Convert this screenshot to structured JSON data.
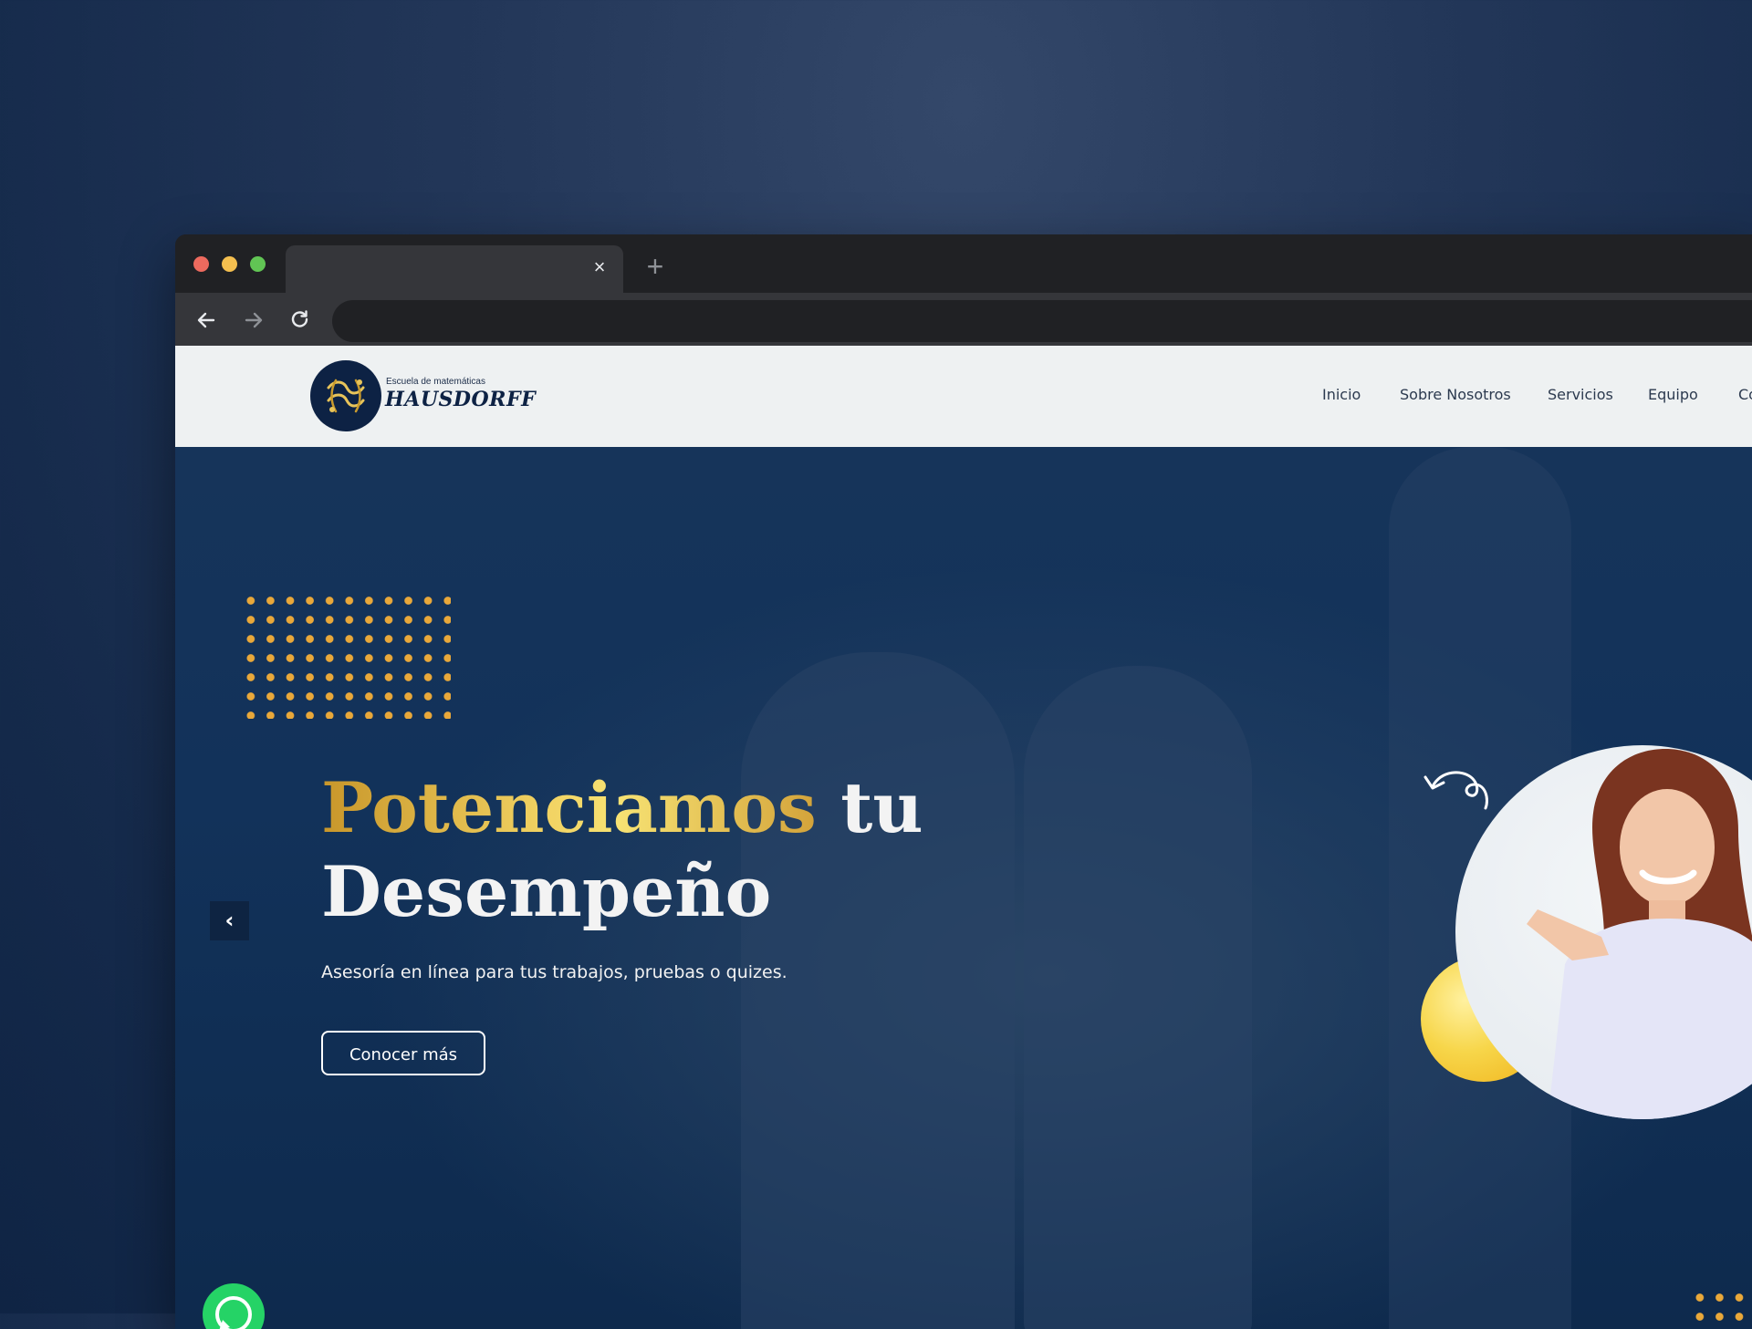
{
  "browser": {
    "tab": {
      "title": "",
      "close_glyph": "×"
    },
    "new_tab_glyph": "+",
    "address": ""
  },
  "site": {
    "logo": {
      "subtitle": "Escuela de matemáticas",
      "name": "HAUSDORFF"
    },
    "nav": [
      {
        "label": "Inicio"
      },
      {
        "label": "Sobre Nosotros"
      },
      {
        "label": "Servicios"
      },
      {
        "label": "Equipo"
      },
      {
        "label": "Co"
      }
    ]
  },
  "hero": {
    "headline_gold": "Potenciamos",
    "headline_rest_line1": " tu",
    "headline_line2": "Desempeño",
    "subtitle": "Asesoría en línea para tus trabajos, pruebas o quizes.",
    "cta_label": "Conocer más",
    "prev_glyph": "‹"
  },
  "colors": {
    "background": "#1b3355",
    "header_bg": "#eef1f2",
    "hero_bg": "#12325a",
    "gold": "#f1d262",
    "dots": "#e9a83a",
    "whatsapp": "#25d366"
  },
  "icons": [
    "back-arrow-icon",
    "forward-arrow-icon",
    "reload-icon",
    "close-icon",
    "plus-icon",
    "whatsapp-icon",
    "curly-arrow-icon",
    "chevron-left-icon"
  ]
}
